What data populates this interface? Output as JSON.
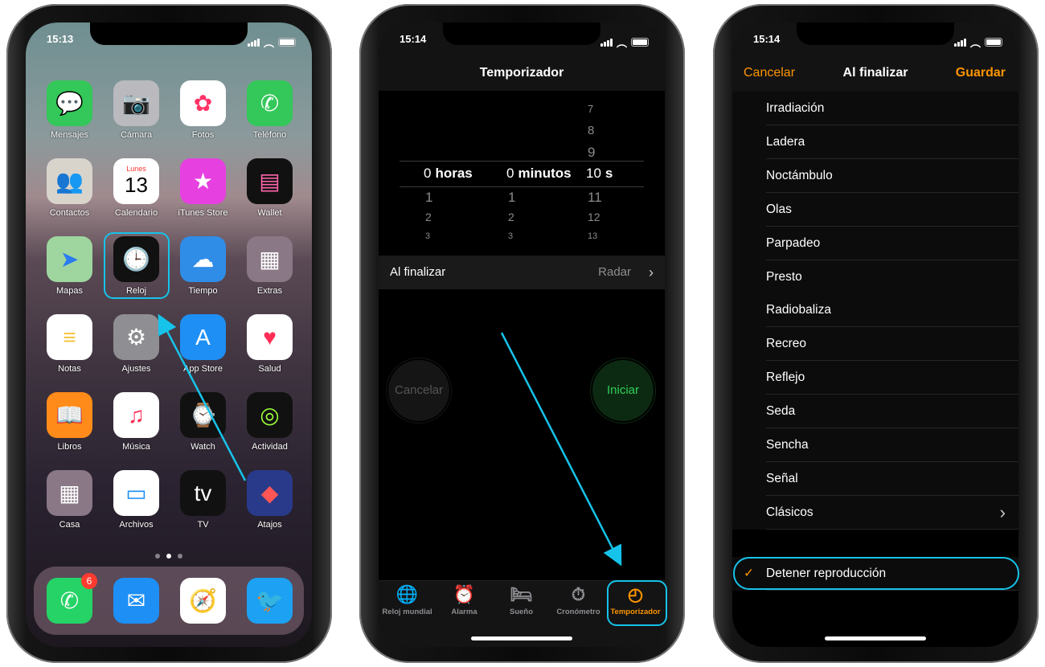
{
  "phone1": {
    "time": "15:13",
    "apps": [
      {
        "label": "Mensajes",
        "icon": "messages-icon",
        "glyph": "💬",
        "bg": "#34c759"
      },
      {
        "label": "Cámara",
        "icon": "camera-icon",
        "glyph": "📷",
        "bg": "#b9b9be"
      },
      {
        "label": "Fotos",
        "icon": "photos-icon",
        "glyph": "✿",
        "bg": "#ffffff",
        "fg": "#f36"
      },
      {
        "label": "Teléfono",
        "icon": "phone-icon",
        "glyph": "✆",
        "bg": "#34c759"
      },
      {
        "label": "Contactos",
        "icon": "contacts-icon",
        "glyph": "👥",
        "bg": "#d8d4cc"
      },
      {
        "label": "Calendario",
        "icon": "calendar-icon",
        "glyph": "13",
        "bg": "#ffffff",
        "fg": "#000",
        "sub": "Lunes"
      },
      {
        "label": "iTunes Store",
        "icon": "star-icon",
        "glyph": "★",
        "bg": "#e640e0"
      },
      {
        "label": "Wallet",
        "icon": "wallet-icon",
        "glyph": "▤",
        "bg": "#111",
        "fg": "#f6a"
      },
      {
        "label": "Mapas",
        "icon": "maps-icon",
        "glyph": "➤",
        "bg": "#9fd6a0",
        "fg": "#2b7bf0"
      },
      {
        "label": "Reloj",
        "icon": "clock-icon",
        "glyph": "🕒",
        "bg": "#111"
      },
      {
        "label": "Tiempo",
        "icon": "weather-icon",
        "glyph": "☁",
        "bg": "#2f8de8"
      },
      {
        "label": "Extras",
        "icon": "folder-icon",
        "glyph": "▦",
        "bg": "#8a7886"
      },
      {
        "label": "Notas",
        "icon": "notes-icon",
        "glyph": "≡",
        "bg": "#fff",
        "fg": "#f5c542"
      },
      {
        "label": "Ajustes",
        "icon": "settings-icon",
        "glyph": "⚙",
        "bg": "#8e8e93"
      },
      {
        "label": "App Store",
        "icon": "app-store-icon",
        "glyph": "A",
        "bg": "#1e8ff5"
      },
      {
        "label": "Salud",
        "icon": "health-icon",
        "glyph": "♥",
        "bg": "#fff",
        "fg": "#ff2d55"
      },
      {
        "label": "Libros",
        "icon": "books-icon",
        "glyph": "📖",
        "bg": "#ff8c1a"
      },
      {
        "label": "Música",
        "icon": "music-icon",
        "glyph": "♫",
        "bg": "#fff",
        "fg": "#fa2d55"
      },
      {
        "label": "Watch",
        "icon": "watch-icon",
        "glyph": "⌚",
        "bg": "#111"
      },
      {
        "label": "Actividad",
        "icon": "activity-icon",
        "glyph": "◎",
        "bg": "#111",
        "fg": "#9cff3a"
      },
      {
        "label": "Casa",
        "icon": "home-folder-icon",
        "glyph": "▦",
        "bg": "#8a7886"
      },
      {
        "label": "Archivos",
        "icon": "files-icon",
        "glyph": "▭",
        "bg": "#fff",
        "fg": "#1e8ff5"
      },
      {
        "label": "TV",
        "icon": "tv-icon",
        "glyph": "tv",
        "bg": "#111"
      },
      {
        "label": "Atajos",
        "icon": "shortcuts-icon",
        "glyph": "◆",
        "bg": "#2a3a8a",
        "fg": "#f55"
      }
    ],
    "dock": [
      {
        "icon": "whatsapp-icon",
        "glyph": "✆",
        "bg": "#25d366",
        "badge": "6"
      },
      {
        "icon": "mail-icon",
        "glyph": "✉",
        "bg": "#1e8ff5"
      },
      {
        "icon": "safari-icon",
        "glyph": "🧭",
        "bg": "#fff"
      },
      {
        "icon": "twitter-icon",
        "glyph": "🐦",
        "bg": "#1da1f2"
      }
    ]
  },
  "phone2": {
    "time": "15:14",
    "title": "Temporizador",
    "picker": {
      "hours": {
        "above": [],
        "selected": "0",
        "unit": "horas",
        "below": [
          "1",
          "2",
          "3"
        ]
      },
      "minutes": {
        "above": [],
        "selected": "0",
        "unit": "minutos",
        "below": [
          "1",
          "2",
          "3"
        ]
      },
      "seconds": {
        "above": [
          "7",
          "8",
          "9"
        ],
        "selected": "10",
        "unit": "s",
        "below": [
          "11",
          "12",
          "13"
        ]
      }
    },
    "on_finish_label": "Al finalizar",
    "on_finish_value": "Radar",
    "cancel": "Cancelar",
    "start": "Iniciar",
    "tabs": [
      {
        "label": "Reloj mundial",
        "icon": "globe-icon",
        "glyph": "🌐"
      },
      {
        "label": "Alarma",
        "icon": "alarm-icon",
        "glyph": "⏰"
      },
      {
        "label": "Sueño",
        "icon": "bed-icon",
        "glyph": "🛏"
      },
      {
        "label": "Cronómetro",
        "icon": "stopwatch-icon",
        "glyph": "⏱"
      },
      {
        "label": "Temporizador",
        "icon": "timer-icon",
        "glyph": "◴",
        "active": true
      }
    ],
    "accent": "#ff9500"
  },
  "phone3": {
    "time": "15:14",
    "cancel": "Cancelar",
    "title": "Al finalizar",
    "save": "Guardar",
    "items": [
      "Irradiación",
      "Ladera",
      "Noctámbulo",
      "Olas",
      "Parpadeo",
      "Presto",
      "Radiobaliza",
      "Recreo",
      "Reflejo",
      "Seda",
      "Sencha",
      "Señal",
      "Clásicos"
    ],
    "stop": "Detener reproducción",
    "stop_checked": true
  },
  "highlight_color": "#16c3ea"
}
